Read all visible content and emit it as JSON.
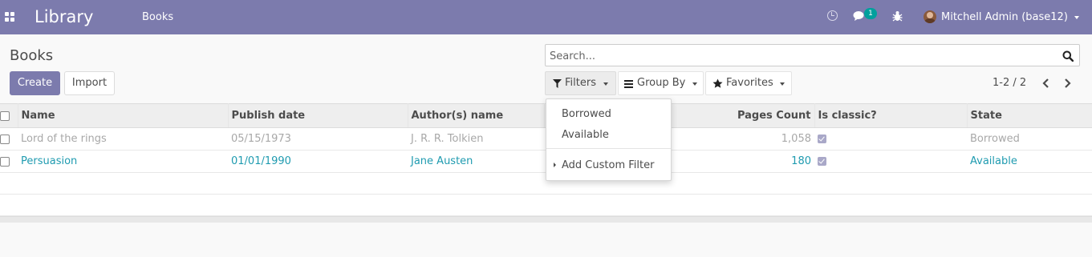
{
  "navbar": {
    "app_title": "Library",
    "menu_books": "Books",
    "chat_count": "1",
    "user_name": "Mitchell Admin (base12)"
  },
  "control_panel": {
    "breadcrumb": "Books",
    "create_label": "Create",
    "import_label": "Import",
    "search_placeholder": "Search...",
    "filters_label": "Filters",
    "group_by_label": "Group By",
    "favorites_label": "Favorites",
    "pager_value": "1-2 / 2"
  },
  "filters_dropdown": {
    "items": [
      "Borrowed",
      "Available"
    ],
    "custom_filter_label": "Add Custom Filter"
  },
  "table": {
    "columns": [
      "Name",
      "Publish date",
      "Author(s) name",
      "Pages Count",
      "Is classic?",
      "State"
    ],
    "rows": [
      {
        "name": "Lord of the rings",
        "publish_date": "05/15/1973",
        "authors": "J. R. R. Tolkien",
        "pages": "1,058",
        "is_classic": true,
        "state": "Borrowed"
      },
      {
        "name": "Persuasion",
        "publish_date": "01/01/1990",
        "authors": "Jane Austen",
        "pages": "180",
        "is_classic": true,
        "state": "Available"
      }
    ]
  },
  "colors": {
    "brand": "#7c7bad",
    "link": "#1f9bb0",
    "badge": "#00a09d"
  },
  "icons": {
    "apps": "apps-grid-icon",
    "activity": "clock-icon",
    "messages": "chat-icon",
    "debug": "bug-icon",
    "search": "search-icon",
    "filter": "filter-icon",
    "group_by": "list-icon",
    "favorites": "star-icon"
  }
}
